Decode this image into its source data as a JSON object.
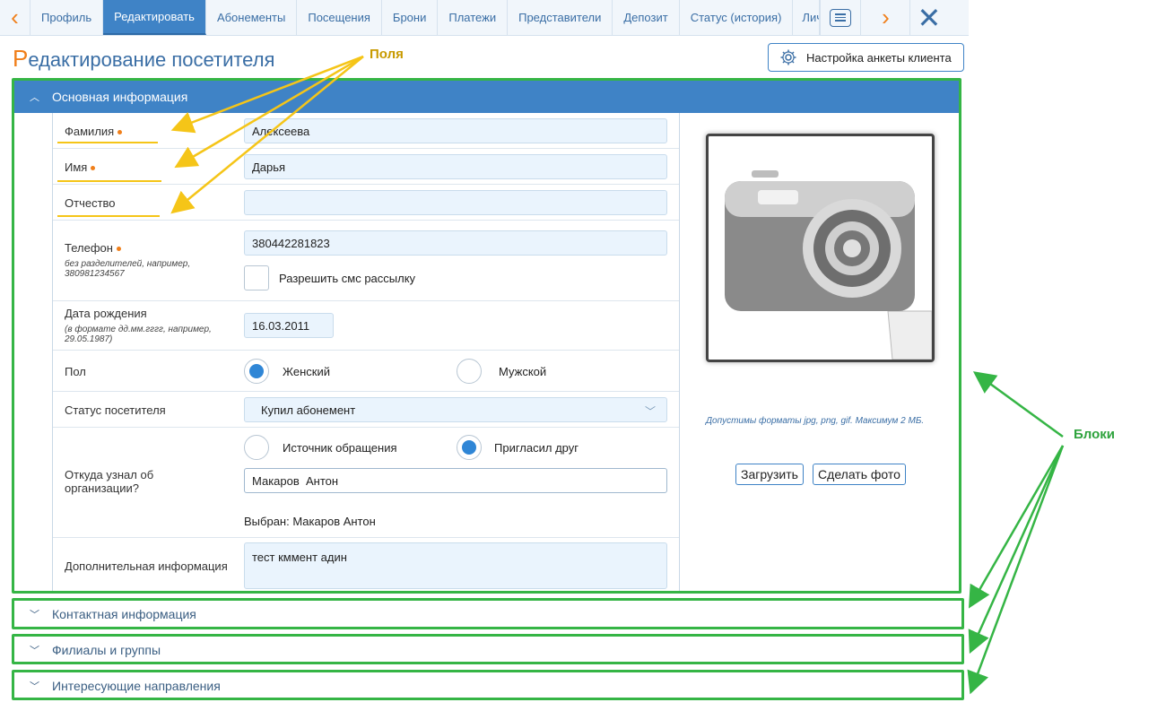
{
  "nav": {
    "tabs": [
      "Профиль",
      "Редактировать",
      "Абонементы",
      "Посещения",
      "Брони",
      "Платежи",
      "Представители",
      "Депозит",
      "Статус (история)",
      "Личн"
    ],
    "active_index": 1
  },
  "title": {
    "first_letter": "Р",
    "rest": "едактирование посетителя"
  },
  "settings_button": "Настройка анкеты клиента",
  "main_block": {
    "header": "Основная информация",
    "fields": {
      "surname_label": "Фамилия",
      "surname_value": "Алексеева",
      "name_label": "Имя",
      "name_value": "Дарья",
      "patronymic_label": "Отчество",
      "patronymic_value": "",
      "phone_label": "Телефон",
      "phone_hint": "без разделителей, например, 380981234567",
      "phone_value": "380442281823",
      "sms_label": "Разрешить смс рассылку",
      "birth_label": "Дата рождения",
      "birth_hint": "(в формате дд.мм.гггг, например, 29.05.1987)",
      "birth_value": "16.03.2011",
      "gender_label": "Пол",
      "gender_female": "Женский",
      "gender_male": "Мужской",
      "status_label": "Статус посетителя",
      "status_value": "Купил абонемент",
      "source_label": "Откуда узнал об организации?",
      "source_option1": "Источник обращения",
      "source_option2": "Пригласил друг",
      "source_value": "Макаров  Антон",
      "source_selected": "Выбран: Макаров Антон",
      "extra_label": "Дополнительная информация",
      "extra_value": "тест кммент адин"
    },
    "photo": {
      "upload_button": "Загрузить",
      "take_photo_button": "Сделать фото",
      "hint": "Допустимы форматы jpg, png, gif. Максимум 2 МБ."
    }
  },
  "collapsed_blocks": [
    "Контактная информация",
    "Филиалы и группы",
    "Интересующие направления"
  ],
  "annotations": {
    "fields": "Поля",
    "blocks": "Блоки"
  },
  "colors": {
    "accent": "#3f83c6",
    "orange": "#f07f1a",
    "annotation_yellow": "#f5c518",
    "annotation_green": "#35b545"
  }
}
